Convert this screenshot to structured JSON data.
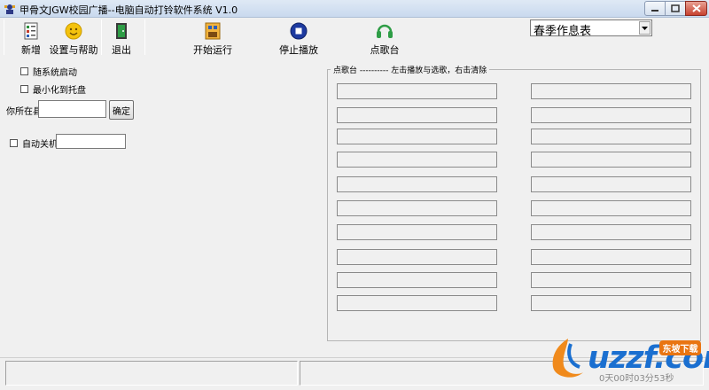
{
  "window": {
    "title": "甲骨文JGW校园广播--电脑自动打铃软件系统 V1.0"
  },
  "toolbar": {
    "new_label": "新增",
    "settings_label": "设置与帮助",
    "exit_label": "退出",
    "start_label": "开始运行",
    "stop_label": "停止播放",
    "request_label": "点歌台"
  },
  "schedule": {
    "selected": "春季作息表"
  },
  "options": {
    "autostart_label": "随系统启动",
    "minimize_tray_label": "最小化到托盘",
    "county_label": "你所在县",
    "county_value": "",
    "confirm_label": "确定",
    "auto_shutdown_label": "自动关机",
    "shutdown_value": ""
  },
  "request_panel": {
    "legend": "点歌台 ---------- 左击播放与选歌，右击清除",
    "slot_count": 20
  },
  "watermark": {
    "brand": "uzzf.com",
    "badge": "东坡下载",
    "sub": "0天00时03分53秒"
  },
  "colors": {
    "accent": "#1a6fd0",
    "badge": "#e97512",
    "close": "#c7412f"
  },
  "icons": [
    "app-icon",
    "new-icon",
    "settings-icon",
    "exit-icon",
    "start-icon",
    "stop-icon",
    "request-icon"
  ]
}
